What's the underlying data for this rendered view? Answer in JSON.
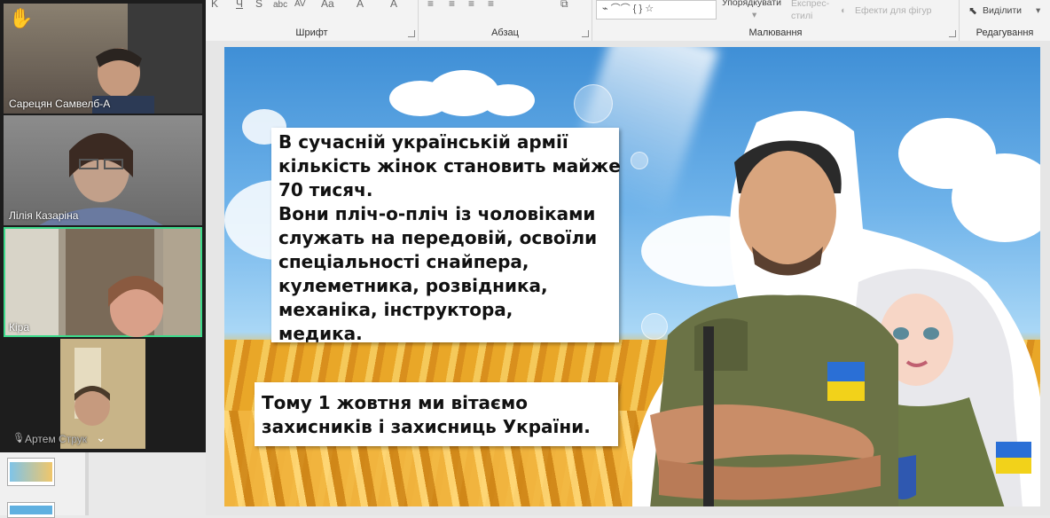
{
  "ribbon": {
    "groups": {
      "font": "Шрифт",
      "paragraph": "Абзац",
      "drawing": "Малювання",
      "editing": "Редагування"
    },
    "arrange_label": "Упорядкувати",
    "quick_styles_label": "Експрес-стилі",
    "shape_effects_label": "Ефекти для фігур",
    "select_label": "Виділити"
  },
  "participants": [
    {
      "name": "Сарецян Самвелб-А"
    },
    {
      "name": "Лілія Казаріна"
    },
    {
      "name": "Кіра"
    },
    {
      "name": "Артем Струк"
    }
  ],
  "slide": {
    "main_text_lines": [
      "В сучасній українській армії",
      "кількість жінок становить майже",
      "70 тисяч.",
      "Вони пліч-о-пліч із чоловіками",
      "служать на передовій, освоїли",
      "спеціальності снайпера,",
      "кулеметника, розвідника,",
      "механіка, інструктора,",
      "медика."
    ],
    "greeting_lines": [
      "Тому 1 жовтня ми вітаємо",
      "захисників і захисниць України."
    ]
  },
  "colors": {
    "ribbon_bg": "#f3f3f3",
    "active_speaker_border": "#3cd98a",
    "hand_icon": "#f5b800"
  },
  "icons": [
    "raise-hand-icon",
    "chevron-down-icon",
    "mic-muted-icon",
    "select-cursor-icon",
    "shape-effects-icon"
  ]
}
